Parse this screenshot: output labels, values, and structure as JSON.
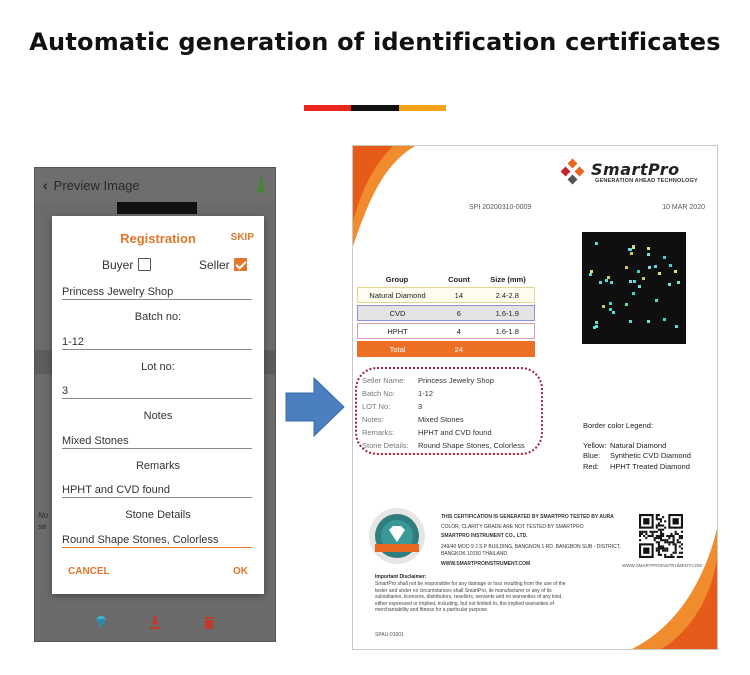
{
  "headline": "Automatic generation of identification certificates",
  "colors": {
    "accent": "#e2772e",
    "total_orange": "#ed6f24",
    "arrow": "#4a7fc0",
    "bar": [
      "#e8261b",
      "#111111",
      "#f3a21b"
    ]
  },
  "phone": {
    "header": {
      "back_icon": "chevron-left-icon",
      "title": "Preview Image",
      "status_icon": "thermometer-icon"
    },
    "side_text": [
      "No",
      "se"
    ],
    "dialog": {
      "title": "Registration",
      "skip_label": "SKIP",
      "buyer_label": "Buyer",
      "buyer_checked": false,
      "seller_label": "Seller",
      "seller_checked": true,
      "seller_name_value": "Princess Jewelry Shop",
      "batch_label": "Batch no:",
      "batch_value": "1-12",
      "lot_label": "Lot no:",
      "lot_value": "3",
      "notes_label": "Notes",
      "notes_value": "Mixed Stones",
      "remarks_label": "Remarks",
      "remarks_value": "HPHT and CVD found",
      "stone_label": "Stone Details",
      "stone_value": "Round Shape Stones, Colorless",
      "cancel_label": "CANCEL",
      "ok_label": "OK"
    },
    "bottom_icons": [
      "diamond-icon",
      "download-icon",
      "delete-icon"
    ]
  },
  "certificate": {
    "brand": "SmartPro",
    "tagline": "GENERATION AHEAD TECHNOLOGY",
    "number": "SPI 20200310-0009",
    "date": "10 MAR 2020",
    "table": {
      "headers": [
        "Group",
        "Count",
        "Size (mm)"
      ],
      "rows": [
        {
          "group": "Natural Diamond",
          "count": "14",
          "size": "2.4-2.8"
        },
        {
          "group": "CVD",
          "count": "6",
          "size": "1.6-1.9"
        },
        {
          "group": "HPHT",
          "count": "4",
          "size": "1.6-1.8"
        }
      ],
      "total_label": "Total",
      "total_count": "24"
    },
    "details": [
      {
        "key": "Seller Name:",
        "value": "Princess Jewelry Shop"
      },
      {
        "key": "Batch No:",
        "value": "1-12"
      },
      {
        "key": "LOT No:",
        "value": "3"
      },
      {
        "key": "Notes:",
        "value": "Mixed Stones"
      },
      {
        "key": "Remarks:",
        "value": "HPHT and CVD found"
      },
      {
        "key": "Stone Details:",
        "value": "Round Shape Stones, Colorless"
      }
    ],
    "legend": {
      "title": "Border color Legend:",
      "items": [
        {
          "key": "Yellow:",
          "value": "Natural Diamond"
        },
        {
          "key": "Blue:",
          "value": "Synthetic CVD Diamond"
        },
        {
          "key": "Red:",
          "value": "HPHT Treated Diamond"
        }
      ]
    },
    "footer": {
      "line1": "THIS CERTIFICATION IS GENERATED BY SMARTPRO TESTED BY AURA",
      "line2": "COLOR, CLARITY GRADE ARE NOT TESTED BY SMARTPRO",
      "line3": "SMARTPRO INSTRUMENT CO., LTD.",
      "line4": "249/40 MOO 9 J.S.P BUILDING, BANGNON 1 RD. BANGBON SUB - DISTRICT,",
      "line5": "BANGKOK 10150 THAILAND.",
      "line6": "WWW.SMARTPROINSTRUMENT.COM",
      "qr_url": "WWW.SMARTPROINSTRUMENT.COM",
      "disclaimer_title": "Important Disclaimer:",
      "disclaimer_lines": [
        "SmartPro shall not be responsible for any damage or loss resulting from the use of the",
        "tester and under no circumstances shall SmartPro, its manufacturer or any of its",
        "subsidiaries, licensors, distributors, resellers, servants and no warranties of any kind,",
        "either expressed or implied, including, but not limited to, the implied warranties of",
        "merchantability and fitness for a particular purpose."
      ],
      "code": "SPAU-01001"
    }
  }
}
